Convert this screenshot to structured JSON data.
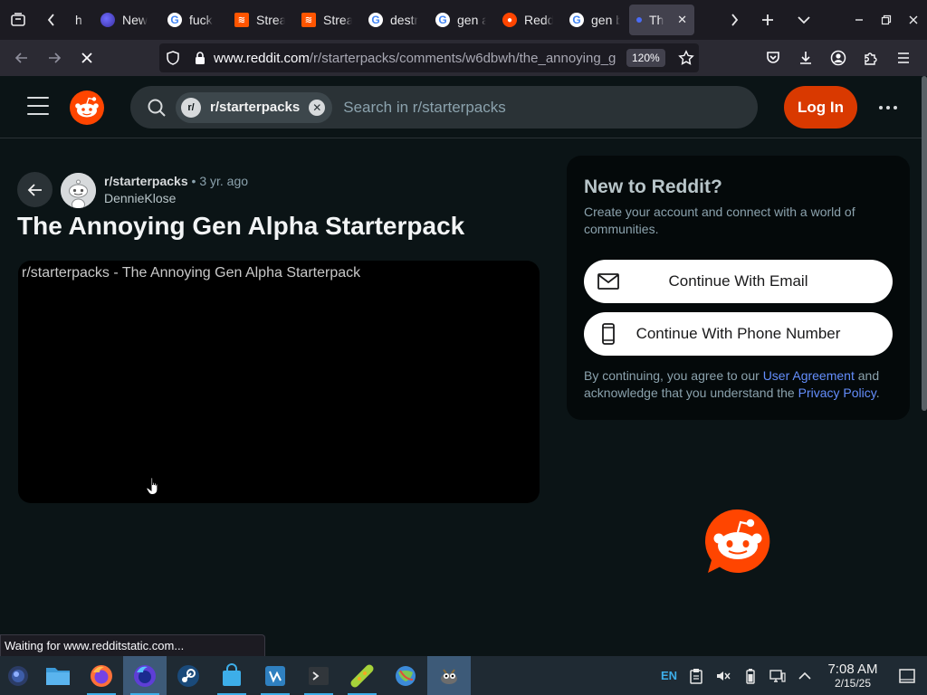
{
  "browser": {
    "tabs": [
      {
        "label": "h",
        "favicon": "firefox-view-icon"
      },
      {
        "label": "New",
        "favicon": "firefox-icon"
      },
      {
        "label": "fuck",
        "favicon": "google-icon"
      },
      {
        "label": "Strea",
        "favicon": "soundcloud-icon"
      },
      {
        "label": "Strea",
        "favicon": "soundcloud-icon"
      },
      {
        "label": "destr",
        "favicon": "google-icon"
      },
      {
        "label": "gen a",
        "favicon": "google-icon"
      },
      {
        "label": "Redd",
        "favicon": "reddit-icon"
      },
      {
        "label": "gen b",
        "favicon": "google-icon"
      },
      {
        "label": "Th",
        "favicon": "loading-dot-icon",
        "active": true
      }
    ],
    "url": {
      "host": "www.reddit.com",
      "path": "/r/starterpacks/comments/w6dbwh/the_annoying_g"
    },
    "zoom": "120%",
    "status_text": "Waiting for www.redditstatic.com..."
  },
  "reddit": {
    "search": {
      "chip_label": "r/starterpacks",
      "chip_avatar": "r/",
      "placeholder": "Search in r/starterpacks"
    },
    "login_label": "Log In",
    "post": {
      "subreddit": "r/starterpacks",
      "separator": "•",
      "time": "3 yr. ago",
      "author": "DennieKlose",
      "title": "The Annoying Gen Alpha Starterpack",
      "media_alt": "r/starterpacks - The Annoying Gen Alpha Starterpack"
    },
    "signup": {
      "title": "New to Reddit?",
      "description": "Create your account and connect with a world of communities.",
      "email_button": "Continue With Email",
      "phone_button": "Continue With Phone Number",
      "terms_prefix": "By continuing, you agree to our ",
      "user_agreement": "User Agreement",
      "terms_middle": " and acknowledge that you understand the ",
      "privacy_policy": "Privacy Policy",
      "terms_suffix": "."
    }
  },
  "taskbar": {
    "apps": [
      "start-menu",
      "file-manager",
      "firefox",
      "firefox-nightly",
      "steam",
      "app-store",
      "vscodium",
      "terminal",
      "lutris",
      "marble",
      "gimp"
    ],
    "keyboard_layout": "EN",
    "time": "7:08 AM",
    "date": "2/15/25"
  },
  "colors": {
    "reddit_orange": "#ff4500",
    "login_button": "#d93900",
    "link_blue": "#648efc",
    "page_bg": "#0b1416"
  }
}
